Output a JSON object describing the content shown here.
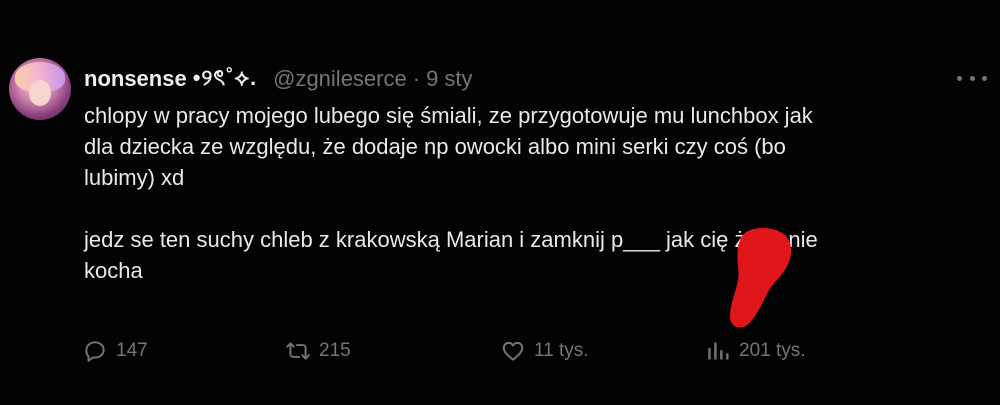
{
  "tweet": {
    "author": {
      "display_name": "nonsense",
      "name_decoration": "•୨ৎ˚⟡.",
      "handle": "@zgnileserce",
      "time": "9 sty",
      "separator": "·"
    },
    "paragraphs": [
      "chlopy w pracy mojego lubego się śmiali, ze przygotowuje mu lunchbox jak\ndla dziecka ze względu, że dodaje np owocki albo mini serki czy coś (bo\nlubimy) xd",
      "jedz se ten suchy chleb z krakowską Marian i zamknij p___ jak cię żona nie\nkocha"
    ],
    "stats": {
      "replies": "147",
      "retweets": "215",
      "likes": "11 tys.",
      "views": "201 tys."
    }
  },
  "colors": {
    "background": "#000000",
    "text": "#e7e9ea",
    "muted": "#71767b",
    "redaction": "#e0161b"
  },
  "icons": [
    "reply-icon",
    "retweet-icon",
    "like-icon",
    "views-icon",
    "more-icon"
  ]
}
